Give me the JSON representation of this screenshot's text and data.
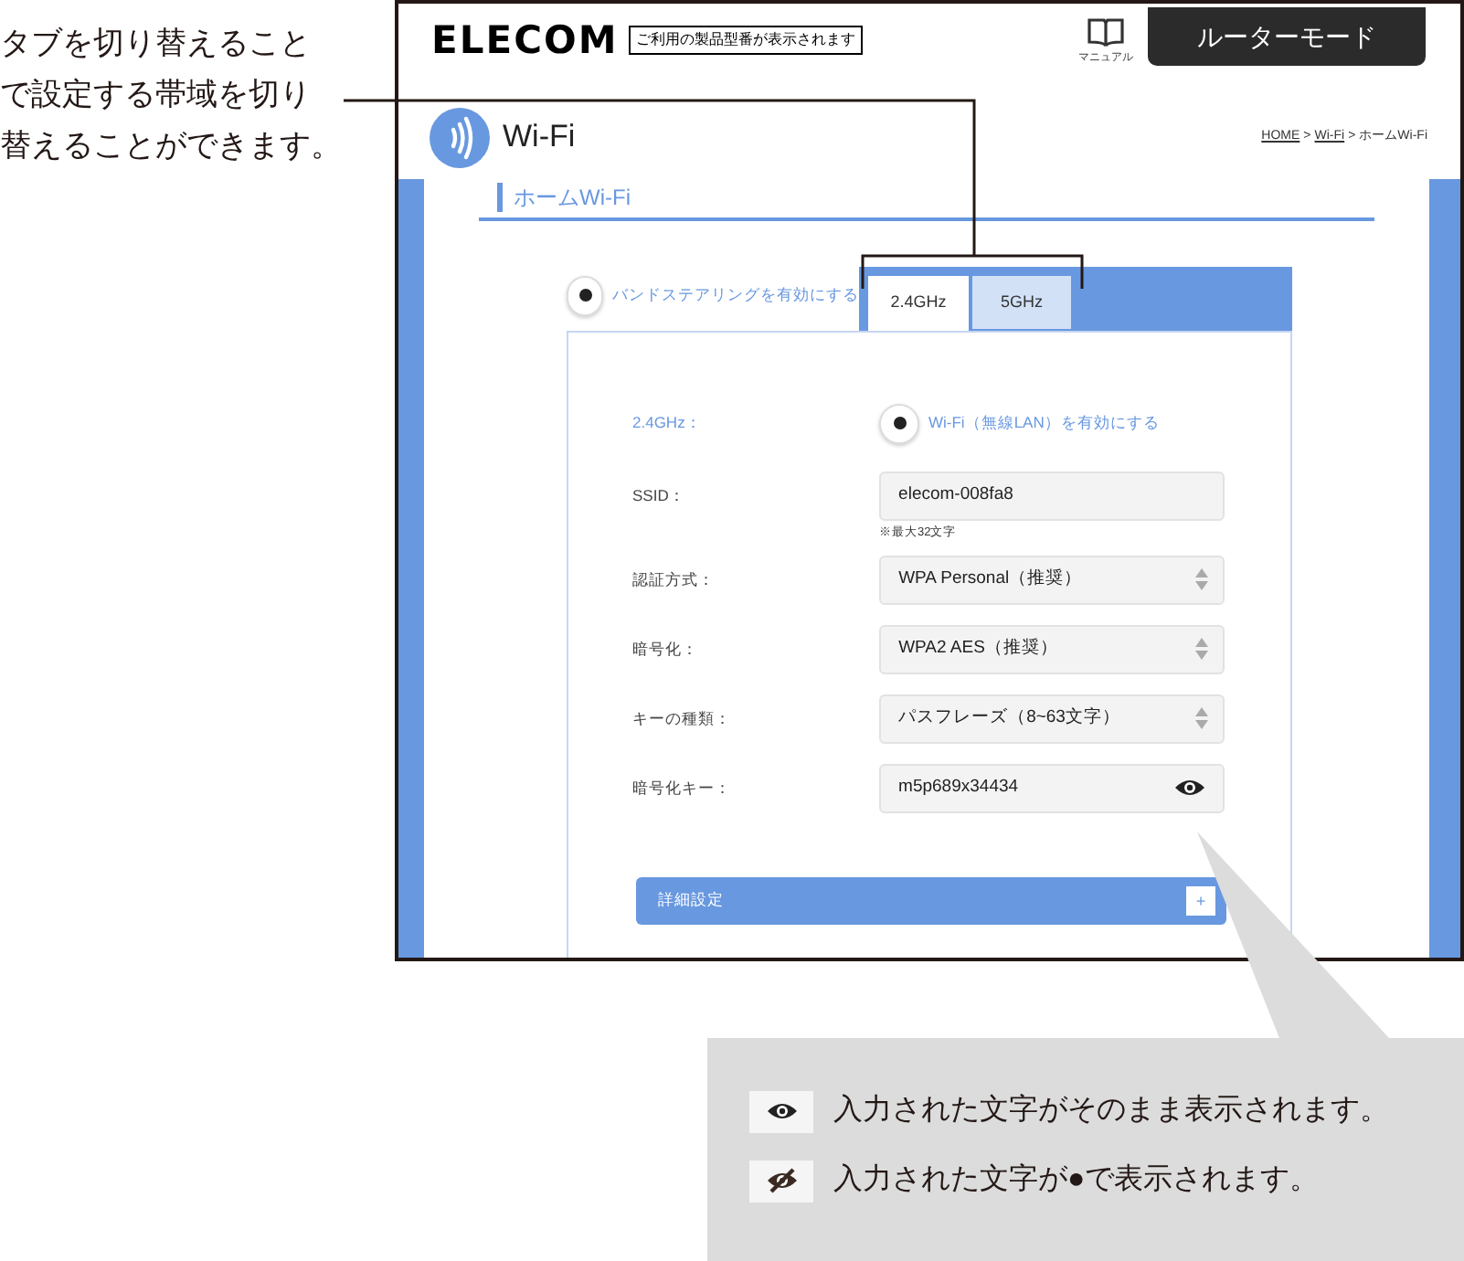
{
  "tab_note": "タブを切り替えることで設定する帯域を切り替えることができます。",
  "screen": {
    "header": {
      "logo": "ELECOM",
      "model_badge": "ご利用の製品型番が表示されます",
      "manual_label": "マニュアル",
      "mode_button": "ルーターモード"
    },
    "page_title": "Wi-Fi",
    "breadcrumb": {
      "separator": ">",
      "items": [
        {
          "label": "HOME",
          "link": true
        },
        {
          "label": "Wi-Fi",
          "link": true
        },
        {
          "label": "ホームWi-Fi",
          "link": false
        }
      ]
    },
    "section_title": "ホームWi-Fi",
    "band_steering": {
      "label": "バンドステアリングを有効にする",
      "checked": true
    },
    "tabs": [
      {
        "label": "2.4GHz",
        "selected": true
      },
      {
        "label": "5GHz",
        "selected": false
      }
    ],
    "rows": [
      {
        "kind": "toggle",
        "label": "2.4GHz：",
        "option": "Wi-Fi（無線LAN）を有効にする",
        "checked": true
      },
      {
        "kind": "text",
        "label": "SSID：",
        "value": "elecom-008fa8",
        "note": "※最大32文字"
      },
      {
        "kind": "select",
        "label": "認証方式：",
        "value": "WPA Personal（推奨）"
      },
      {
        "kind": "select",
        "label": "暗号化：",
        "value": "WPA2 AES（推奨）"
      },
      {
        "kind": "select",
        "label": "キーの種類：",
        "value": "パスフレーズ（8~63文字）"
      },
      {
        "kind": "password",
        "label": "暗号化キー：",
        "value": "m5p689x34434"
      }
    ],
    "advanced": {
      "label": "詳細設定",
      "toggle_symbol": "+"
    }
  },
  "legend": [
    {
      "kind": "eye",
      "text": "入力された文字がそのまま表示されます。"
    },
    {
      "kind": "eye_off",
      "text": "入力された文字が●で表示されます。"
    }
  ]
}
